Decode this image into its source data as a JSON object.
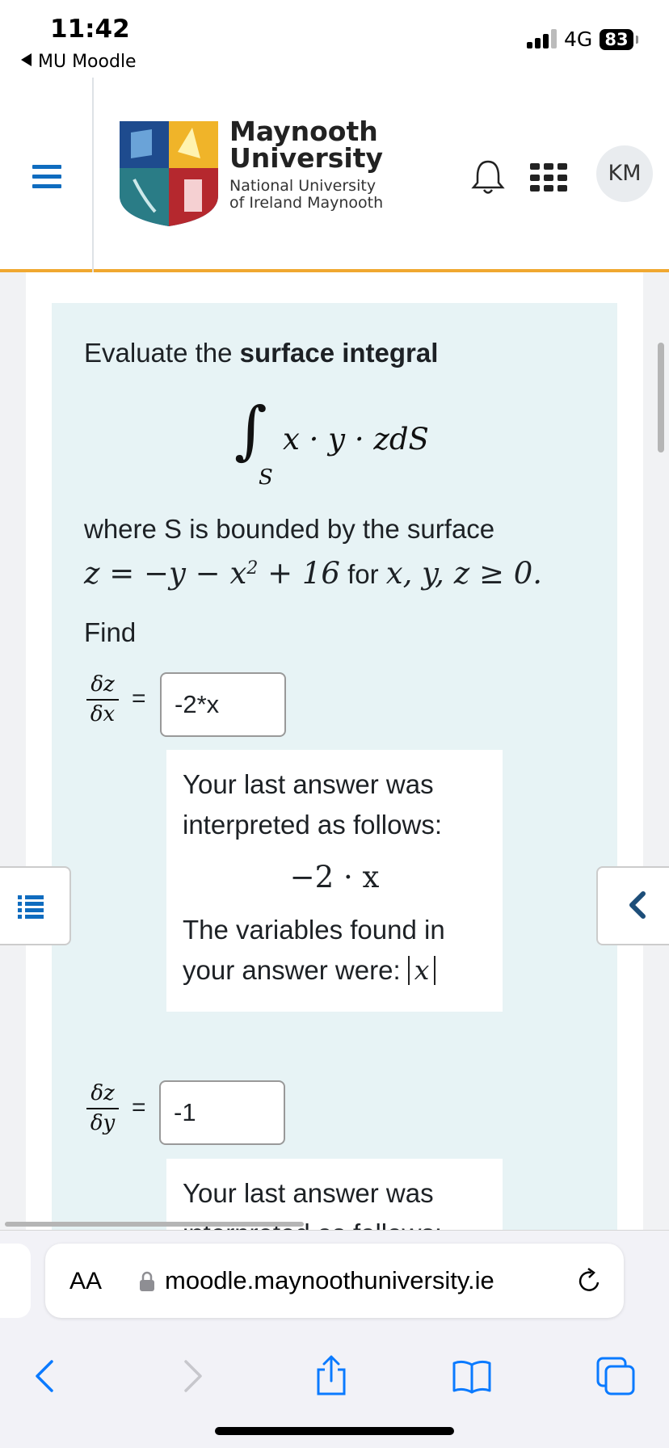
{
  "status_bar": {
    "time": "11:42",
    "back_app": "MU Moodle",
    "network": "4G",
    "battery": "83"
  },
  "header": {
    "logo_title": "Maynooth University",
    "logo_line1": "Maynooth",
    "logo_line2": "University",
    "logo_sub1": "National University",
    "logo_sub2": "of Ireland Maynooth",
    "user_initials": "KM",
    "accent_color": "#f0a830",
    "brand_blue": "#0f6cbf"
  },
  "question": {
    "intro_prefix": "Evaluate the ",
    "intro_bold": "surface integral",
    "integral_sign": "∫",
    "integral_sub": "S",
    "integral_expr": "x · y · zdS",
    "where_text": "where S is bounded by the surface",
    "surface_eq_start": "z = −y − x",
    "surface_exp": "2",
    "surface_eq_end": " + 16",
    "for_text": " for ",
    "condition": "x, y, z ≥ 0.",
    "find_label": "Find",
    "parts": [
      {
        "num": "δz",
        "den": "δx",
        "equals": "=",
        "answer": "-2*x",
        "feedback_line1": "Your last answer was",
        "feedback_line2": "interpreted as follows:",
        "interpreted": "−2 · x",
        "vars_line1": "The variables found in",
        "vars_line2": "your answer were: ",
        "vars": "x"
      },
      {
        "num": "δz",
        "den": "δy",
        "equals": "=",
        "answer": "-1",
        "feedback_line1": "Your last answer was",
        "feedback_line2": "interpreted as follows:"
      }
    ]
  },
  "browser": {
    "aa_label": "AA",
    "url": "moodle.maynoothuniversity.ie"
  }
}
